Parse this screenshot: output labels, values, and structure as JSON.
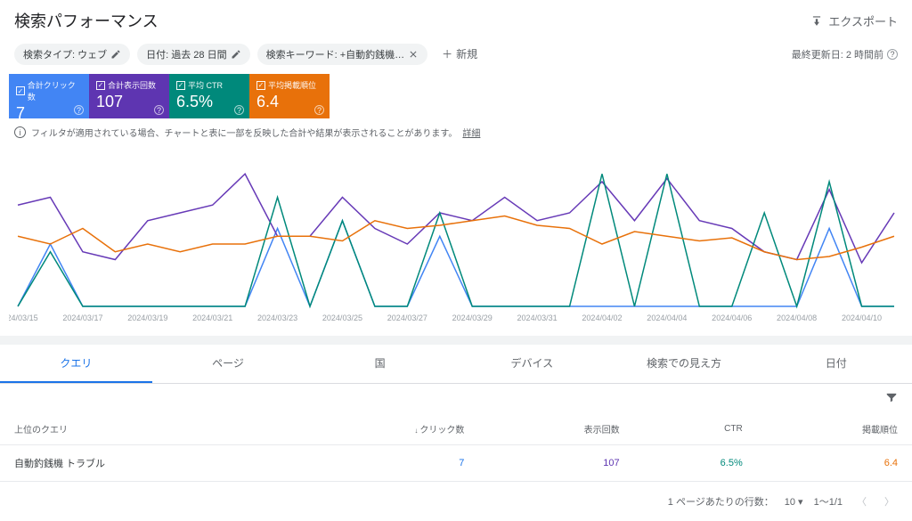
{
  "header": {
    "title": "検索パフォーマンス",
    "export_label": "エクスポート"
  },
  "filters": {
    "search_type": "検索タイプ: ウェブ",
    "date_range": "日付: 過去 28 日間",
    "query_filter": "検索キーワード: +自動釣銭機…",
    "new_label": "新規",
    "last_updated": "最終更新日: 2 時間前"
  },
  "metrics": {
    "clicks": {
      "label": "合計クリック数",
      "value": "7"
    },
    "impressions": {
      "label": "合計表示回数",
      "value": "107"
    },
    "ctr": {
      "label": "平均 CTR",
      "value": "6.5%"
    },
    "position": {
      "label": "平均掲載順位",
      "value": "6.4"
    }
  },
  "notice": {
    "text": "フィルタが適用されている場合、チャートと表に一部を反映した合計や結果が表示されることがあります。",
    "link": "詳細"
  },
  "chart_data": {
    "type": "line",
    "x_labels": [
      "2024/03/15",
      "2024/03/17",
      "2024/03/19",
      "2024/03/21",
      "2024/03/23",
      "2024/03/25",
      "2024/03/27",
      "2024/03/29",
      "2024/03/31",
      "2024/04/02",
      "2024/04/04",
      "2024/04/06",
      "2024/04/08",
      "2024/04/10"
    ],
    "series": [
      {
        "name": "clicks",
        "color": "#4285f4",
        "values": [
          0,
          40,
          0,
          0,
          0,
          0,
          0,
          0,
          50,
          0,
          55,
          0,
          0,
          45,
          0,
          0,
          0,
          0,
          0,
          0,
          0,
          0,
          0,
          0,
          0,
          50,
          0,
          0
        ]
      },
      {
        "name": "impressions",
        "color": "#673ab7",
        "values": [
          65,
          70,
          35,
          30,
          55,
          60,
          65,
          85,
          45,
          45,
          70,
          50,
          40,
          60,
          55,
          70,
          55,
          60,
          80,
          55,
          82,
          55,
          50,
          35,
          30,
          75,
          28,
          60
        ]
      },
      {
        "name": "ctr",
        "color": "#00897b",
        "values": [
          0,
          35,
          0,
          0,
          0,
          0,
          0,
          0,
          70,
          0,
          55,
          0,
          0,
          60,
          0,
          0,
          0,
          0,
          85,
          0,
          85,
          0,
          0,
          60,
          0,
          80,
          0,
          0
        ]
      },
      {
        "name": "position",
        "color": "#e8710a",
        "values": [
          45,
          40,
          50,
          35,
          40,
          35,
          40,
          40,
          45,
          45,
          42,
          55,
          50,
          52,
          55,
          58,
          52,
          50,
          40,
          48,
          45,
          42,
          44,
          35,
          30,
          32,
          38,
          45
        ]
      }
    ]
  },
  "tabs": [
    "クエリ",
    "ページ",
    "国",
    "デバイス",
    "検索での見え方",
    "日付"
  ],
  "table": {
    "headers": {
      "query": "上位のクエリ",
      "clicks": "クリック数",
      "impressions": "表示回数",
      "ctr": "CTR",
      "position": "掲載順位"
    },
    "rows": [
      {
        "query": "自動釣銭機 トラブル",
        "clicks": "7",
        "impressions": "107",
        "ctr": "6.5%",
        "position": "6.4"
      }
    ]
  },
  "pagination": {
    "per_page_label": "1 ページあたりの行数：",
    "per_page_value": "10",
    "range": "1～1/1"
  }
}
